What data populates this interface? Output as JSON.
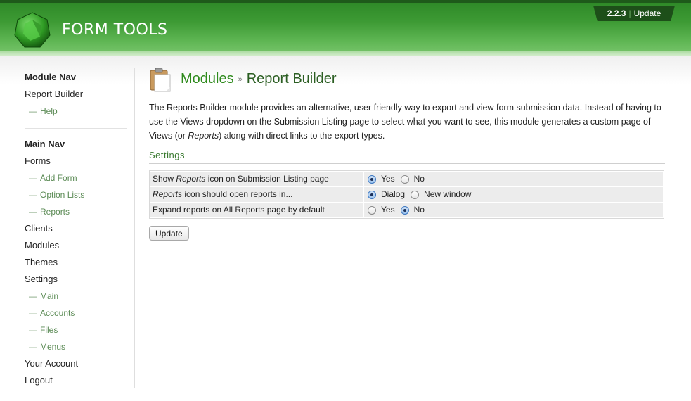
{
  "header": {
    "app_title": "FORM TOOLS",
    "version": "2.2.3",
    "update_link": "Update"
  },
  "sidebar": {
    "module_nav_heading": "Module Nav",
    "module_nav": [
      {
        "label": "Report Builder",
        "sub": false
      },
      {
        "label": "Help",
        "sub": true
      }
    ],
    "main_nav_heading": "Main Nav",
    "main_nav": [
      {
        "label": "Forms",
        "sub": false
      },
      {
        "label": "Add Form",
        "sub": true
      },
      {
        "label": "Option Lists",
        "sub": true
      },
      {
        "label": "Reports",
        "sub": true
      },
      {
        "label": "Clients",
        "sub": false
      },
      {
        "label": "Modules",
        "sub": false
      },
      {
        "label": "Themes",
        "sub": false
      },
      {
        "label": "Settings",
        "sub": false
      },
      {
        "label": "Main",
        "sub": true
      },
      {
        "label": "Accounts",
        "sub": true
      },
      {
        "label": "Files",
        "sub": true
      },
      {
        "label": "Menus",
        "sub": true
      },
      {
        "label": "Your Account",
        "sub": false
      },
      {
        "label": "Logout",
        "sub": false
      }
    ]
  },
  "main": {
    "breadcrumb_parent": "Modules",
    "breadcrumb_sep": "»",
    "breadcrumb_current": "Report Builder",
    "intro_part1": "The Reports Builder module provides an alternative, user friendly way to export and view form submission data. Instead of having to use the Views dropdown on the Submission Listing page to select what you want to see, this module generates a custom page of Views (or ",
    "intro_em": "Reports",
    "intro_part2": ") along with direct links to the export types.",
    "settings_heading": "Settings",
    "settings": [
      {
        "label_pre": "Show ",
        "label_em": "Reports",
        "label_post": " icon on Submission Listing page",
        "options": [
          {
            "label": "Yes",
            "checked": true
          },
          {
            "label": "No",
            "checked": false
          }
        ]
      },
      {
        "label_pre": "",
        "label_em": "Reports",
        "label_post": " icon should open reports in...",
        "options": [
          {
            "label": "Dialog",
            "checked": true
          },
          {
            "label": "New window",
            "checked": false
          }
        ]
      },
      {
        "label_pre": "Expand reports on All Reports page by default",
        "label_em": "",
        "label_post": "",
        "options": [
          {
            "label": "Yes",
            "checked": false
          },
          {
            "label": "No",
            "checked": true
          }
        ]
      }
    ],
    "update_button": "Update"
  },
  "colors": {
    "header_green": "#3d9a34",
    "link_green": "#2e8a1c",
    "sub_nav_green": "#5a8a54"
  },
  "icons": {
    "logo": "form-tools-logo",
    "page": "clipboard-icon"
  }
}
